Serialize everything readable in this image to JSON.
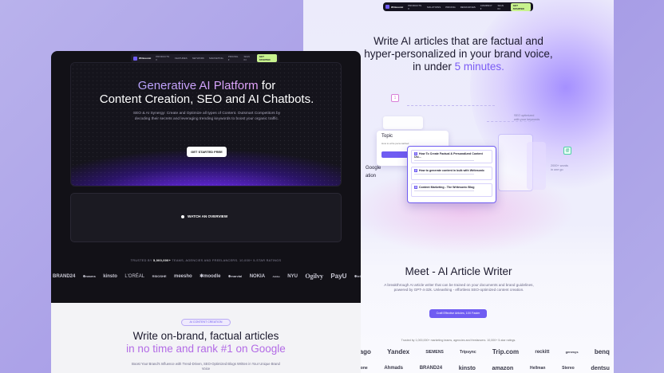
{
  "right": {
    "nav": {
      "brand": "Writesonic",
      "items": [
        "PRODUCTS ▾",
        "SOLUTIONS",
        "PRICING",
        "RESOURCES",
        "COMPANY ▾"
      ],
      "signin": "SIGN IN",
      "cta": "GET STARTED"
    },
    "title_line1": "Write AI articles that are factual and",
    "title_line2": "hyper-personalized in your brand voice,",
    "title_line3_pre": "in under ",
    "title_line3_hl": "5 minutes.",
    "topic_card": {
      "title": "Topic",
      "sub": "How to write personalized"
    },
    "list_items": [
      "How To Create Factual & Personalized Content Usi...",
      "How to generate content in bulk with Writesonic",
      "Content Marketing - The Writesonic Blog"
    ],
    "side_left_1": "Google",
    "side_left_2": "ation",
    "ann_1": "SEO optimized",
    "ann_2": "with your keywords",
    "ann_3": "2000+ words",
    "ann_4": "in one go",
    "icon_1": "1",
    "icon_2": "@",
    "meet_title": "Meet - AI Article Writer",
    "meet_desc": "A breakthrough AI article writer that can be trained on your documents and brand guidelines, powered by GPT-4-32k. Unleashing - effortless SEO-optimized content creation.",
    "meet_btn": "Craft Effective Articles, 10X Faster",
    "trusted": "Trusted by 1,000,000+ marketing teams, agencies and freelancers. 10,000+ 5-star ratings.",
    "logos_row1": [
      "ivago",
      "Yandex",
      "SIEMENS",
      "Tripsync",
      "Trip.com",
      "reckitt",
      "genesys",
      "benq"
    ],
    "logos_row2": [
      "dofone",
      "Ahmads",
      "BRAND24",
      "kinsto",
      "amazon",
      "Hellman",
      "Stereo",
      "dentsu"
    ]
  },
  "left": {
    "nav": {
      "brand": "Writesonic",
      "items": [
        "PRODUCTS ▾",
        "FEATURES",
        "NETWORK",
        "MARKETING",
        "PRICING ▾"
      ],
      "signin": "SIGN IN",
      "cta": "GET STARTED"
    },
    "hero_title_g": "Generative AI Platform",
    "hero_title_rest": " for",
    "hero_title_line2": "Content Creation, SEO and AI Chatbots.",
    "hero_desc": "SEO & AI Synergy: Create and Optimize all types of Content. Outsmart Competitors by decoding their secrets and leveraging trending keywords to boost your organic traffic.",
    "hero_btn": "GET STARTED FREE",
    "video_label": "WATCH AN OVERVIEW",
    "trusted_pre": "TRUSTED BY ",
    "trusted_num": "5,000,000+",
    "trusted_post": " TEAMS, AGENCIES AND FREELANCERS. 10,000+ 5-STAR RATINGS",
    "logos": [
      "BRAND24",
      "✱nasms",
      "kinsto",
      "L'ORÉAL",
      "RSIOSHE",
      "meesho",
      "✱moodle",
      "✱marvial",
      "NOKIA",
      "Adobe",
      "NYU",
      "Ogilvy",
      "PayU",
      "✱tel"
    ],
    "badge": "AI CONTENT CREATION",
    "bottom_title_1": "Write on-brand, factual articles",
    "bottom_title_2": "in no time and rank #1 on Google",
    "bottom_desc": "Boost Your Brand's Influence with Trend-Driven, SEO-Optimized Blogs Written in Your Unique Brand Voice"
  }
}
